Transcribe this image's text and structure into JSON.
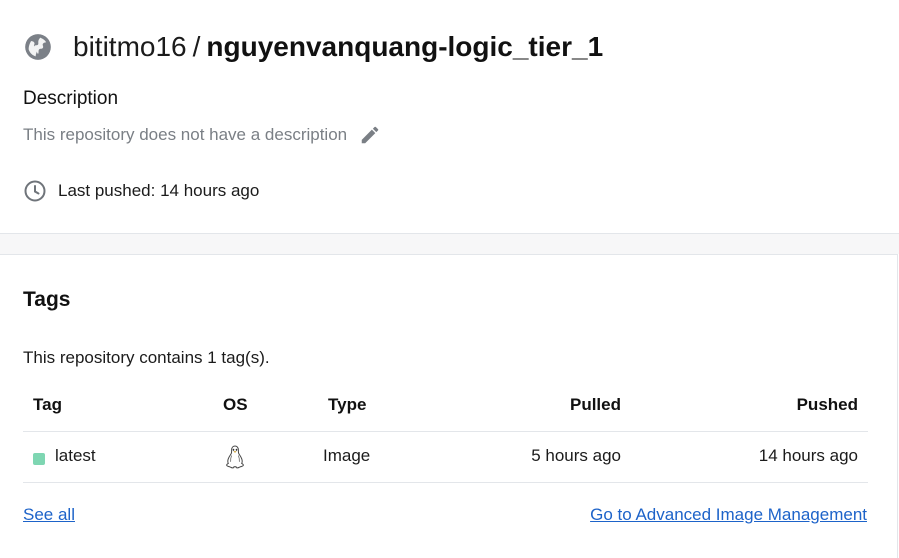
{
  "repo": {
    "namespace": "bititmo16",
    "separator": "/",
    "name": "nguyenvanquang-logic_tier_1",
    "globe_icon": "globe-icon"
  },
  "description": {
    "heading": "Description",
    "text": "This repository does not have a description",
    "edit_icon": "pencil-icon"
  },
  "last_pushed": {
    "text": "Last pushed: 14 hours ago",
    "icon": "clock-icon"
  },
  "tags": {
    "heading": "Tags",
    "count_text": "This repository contains 1 tag(s).",
    "columns": [
      "Tag",
      "OS",
      "Type",
      "Pulled",
      "Pushed"
    ],
    "rows": [
      {
        "tag": "latest",
        "status_color": "#7ed6b2",
        "os_icon": "linux-icon",
        "type": "Image",
        "pulled": "5 hours ago",
        "pushed": "14 hours ago"
      }
    ],
    "see_all": "See all",
    "advanced": "Go to Advanced Image Management"
  },
  "colors": {
    "link": "#1d63c9",
    "muted": "#7a7f85"
  }
}
